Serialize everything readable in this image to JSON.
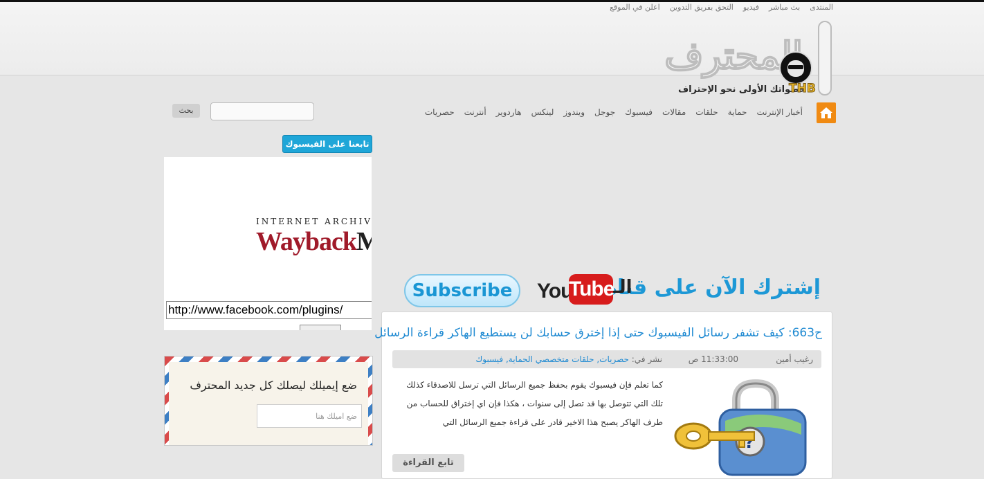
{
  "top_links": [
    "المنتدى",
    "بث مباشر",
    "فيديو",
    "التحق بفريق التدوين",
    "اعلن في الموقع"
  ],
  "logo": {
    "wordmark": "المحترف",
    "tagline": "خطواتك الأولى نحو الإحتراف",
    "badge": "THB"
  },
  "nav": {
    "home_icon": "home-icon",
    "items": [
      "أخبار الإنترنت",
      "حماية",
      "حلقات",
      "مقالات",
      "فيسبوك",
      "جوجل",
      "ويندوز",
      "لينكس",
      "هاردوير",
      "أنترنت",
      "حصريات"
    ]
  },
  "search": {
    "button": "بحث",
    "placeholder": ""
  },
  "sidebar": {
    "facebook_title": "تابعنا على الفيسبوك",
    "wayback_heading": "INTERNET ARCHIVE",
    "wayback_logo_a": "Wayback",
    "wayback_logo_b": "Machine",
    "fb_url": "http://www.facebook.com/plugins/",
    "mail_title": "ضع إيميلك ليصلك كل جديد المحترف",
    "mail_placeholder": "ضع اميلك هنا"
  },
  "banner": {
    "text": "إشترك الآن على قناة",
    "al": "الـ",
    "you": "You",
    "tube": "Tube",
    "subscribe": "Subscribe"
  },
  "post": {
    "title": "ح663: كيف تشفر رسائل الفيسبوك حتى إذا إخترق حسابك لن يستطيع الهاكر قراءة الرسائل",
    "author": "رغيب أمين",
    "time": "11:33:00 ص",
    "posted_in": "نشر في:",
    "categories": "حصريات, حلقات متخصصي الحماية, فيسبوك",
    "excerpt": "كما تعلم فإن فيسبوك يقوم بحفظ جميع الرسائل التي ترسل للاصدقاء كذلك تلك التي تتوصل بها قد تصل إلى سنوات ، هكذا فإن اي إختراق للحساب من طرف الهاكر يصبح هذا الاخير قادر على قراءة جميع الرسائل التي",
    "read_more": "تابع القراءة"
  },
  "colors": {
    "accent": "#1f8ad2",
    "home": "#f08a12",
    "facebook": "#1fa6d8",
    "youtube": "#d71c1c"
  }
}
